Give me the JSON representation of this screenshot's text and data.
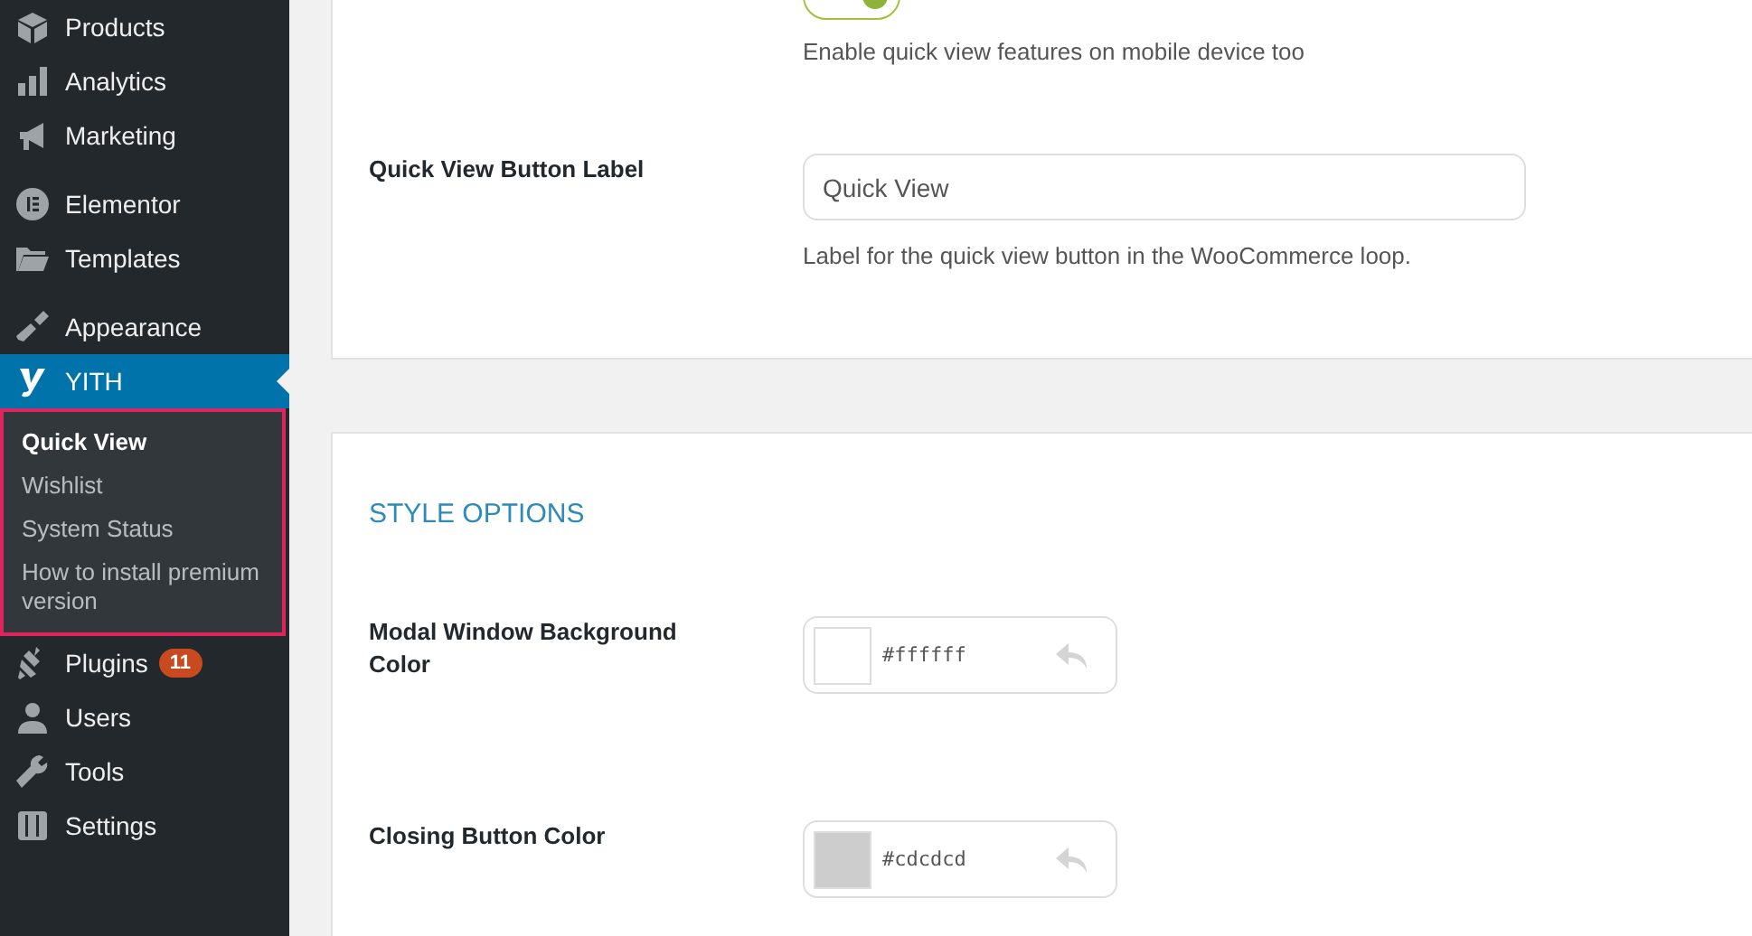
{
  "sidebar": {
    "groups": [
      [
        {
          "label": "Products",
          "selected": false
        },
        {
          "label": "Analytics",
          "selected": false
        },
        {
          "label": "Marketing",
          "selected": false
        }
      ],
      [
        {
          "label": "Elementor",
          "selected": false
        },
        {
          "label": "Templates",
          "selected": false
        }
      ],
      [
        {
          "label": "Appearance",
          "selected": false
        },
        {
          "label": "YITH",
          "selected": true,
          "submenu": [
            {
              "label": "Quick View",
              "selected": true
            },
            {
              "label": "Wishlist",
              "selected": false
            },
            {
              "label": "System Status",
              "selected": false
            },
            {
              "label": "How to install premium version",
              "selected": false
            }
          ]
        },
        {
          "label": "Plugins",
          "selected": false,
          "badge": "11"
        },
        {
          "label": "Users",
          "selected": false
        },
        {
          "label": "Tools",
          "selected": false
        },
        {
          "label": "Settings",
          "selected": false
        }
      ]
    ]
  },
  "cards": [
    {
      "rows": [
        {
          "kind": "toggle",
          "on": true,
          "description": "Enable quick view features on mobile device too"
        },
        {
          "kind": "text",
          "label": "Quick View Button Label",
          "value": "Quick View",
          "description": "Label for the quick view button in the WooCommerce loop."
        }
      ]
    },
    {
      "heading": "STYLE OPTIONS",
      "rows": [
        {
          "kind": "color",
          "label": "Modal Window Background Color",
          "value": "#ffffff",
          "color": "#ffffff"
        },
        {
          "kind": "color",
          "label": "Closing Button Color",
          "value": "#cdcdcd",
          "color": "#cdcdcd"
        }
      ]
    }
  ]
}
